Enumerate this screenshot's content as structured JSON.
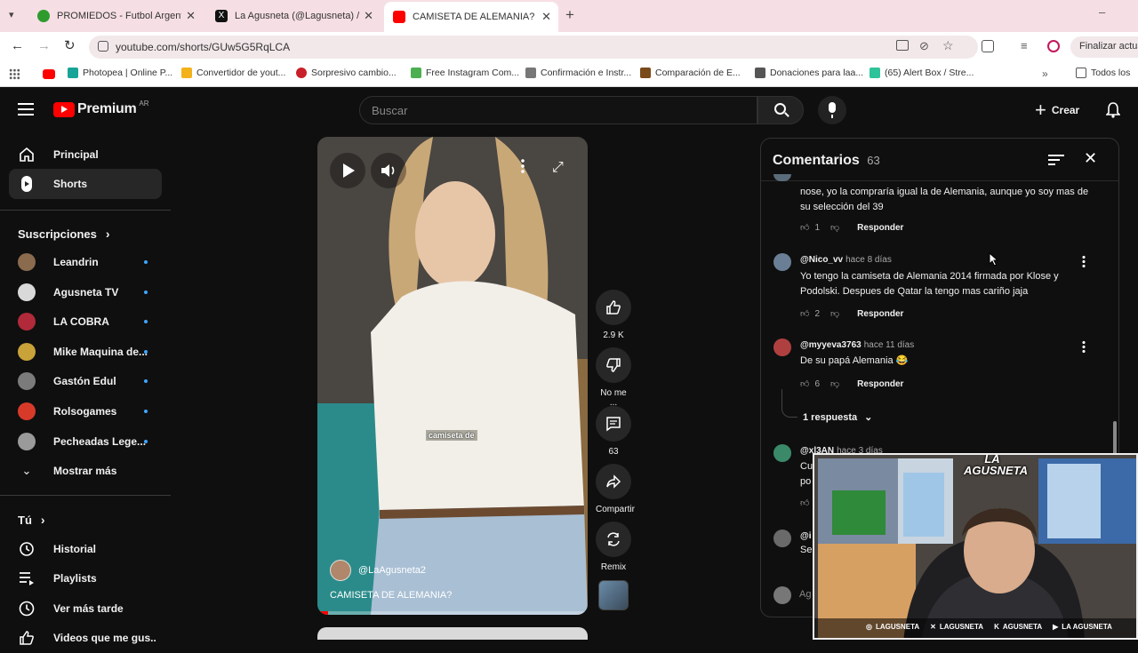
{
  "browser": {
    "tabs": [
      {
        "title": "PROMIEDOS - Futbol Argentino",
        "color": "#2e9b2e"
      },
      {
        "title": "La Agusneta (@Lagusneta) / X",
        "color": "#111111"
      },
      {
        "title": "CAMISETA DE ALEMANIA? - YouTube",
        "color": "#ff0000"
      }
    ],
    "url": "youtube.com/shorts/GUw5G5RqLCA",
    "profile_button": "Finalizar actual",
    "bookmarks": [
      {
        "label": "Photopea | Online P...",
        "color": "#18a497"
      },
      {
        "label": "Convertidor de yout...",
        "color": "#f3b21b"
      },
      {
        "label": "Sorpresivo cambio...",
        "color": "#c8202a"
      },
      {
        "label": "Free Instagram Com...",
        "color": "#4caf50"
      },
      {
        "label": "Confirmación e Instr...",
        "color": "#777777"
      },
      {
        "label": "Comparación de E...",
        "color": "#7a4a1a"
      },
      {
        "label": "Donaciones para laa...",
        "color": "#555555"
      },
      {
        "label": "(65) Alert Box / Stre...",
        "color": "#2fc39a"
      }
    ],
    "all_bookmarks": "Todos los"
  },
  "youtube": {
    "logo_text": "Premium",
    "country": "AR",
    "search_placeholder": "Buscar",
    "create_label": "Crear",
    "sidebar": {
      "main": [
        {
          "label": "Principal",
          "icon": "home-icon"
        },
        {
          "label": "Shorts",
          "icon": "shorts-icon"
        }
      ],
      "subs_title": "Suscripciones",
      "subs": [
        {
          "label": "Leandrin",
          "color": "#8a6b4e"
        },
        {
          "label": "Agusneta TV",
          "color": "#d9d9d9"
        },
        {
          "label": "LA COBRA",
          "color": "#b02a3a"
        },
        {
          "label": "Mike Maquina de...",
          "color": "#c9a23a"
        },
        {
          "label": "Gastón Edul",
          "color": "#7b7b7b"
        },
        {
          "label": "Rolsogames",
          "color": "#d83a2a"
        },
        {
          "label": "Pecheadas Lege...",
          "color": "#9a9a9a"
        }
      ],
      "show_more": "Mostrar más",
      "you_title": "Tú",
      "you": [
        {
          "label": "Historial",
          "icon": "history-icon"
        },
        {
          "label": "Playlists",
          "icon": "playlist-icon"
        },
        {
          "label": "Ver más tarde",
          "icon": "clock-icon"
        },
        {
          "label": "Videos que me gus..",
          "icon": "like-icon"
        }
      ]
    },
    "short": {
      "caption": "camiseta de",
      "channel": "@LaAgusneta2",
      "title": "CAMISETA DE ALEMANIA?"
    },
    "actions": {
      "likes": "2.9 K",
      "dislike": "No me ...",
      "comments": "63",
      "share": "Compartir",
      "remix": "Remix"
    },
    "comments_panel": {
      "title": "Comentarios",
      "count": "63",
      "reply_label": "Responder",
      "replies_toggle": "1 respuesta",
      "add_placeholder": "Ag",
      "comments": [
        {
          "author": "",
          "time": "",
          "text": "nose, yo la compraría igual la de Alemania, aunque yo soy mas de su selección del 39",
          "likes": "1",
          "avatar": "#5a6b7a"
        },
        {
          "author": "@Nico_vv",
          "time": "hace 8 días",
          "text": "Yo tengo la camiseta de Alemania 2014 firmada por Klose y Podolski. Despues de Qatar la tengo mas cariño jaja",
          "likes": "2",
          "avatar": "#6a7f95"
        },
        {
          "author": "@myyeva3763",
          "time": "hace 11 días",
          "text": "De su papá Alemania 😂",
          "likes": "6",
          "avatar": "#b04040"
        },
        {
          "author": "@xl3AN",
          "time": "hace 3 días",
          "text": "Cu",
          "text2": "po",
          "likes": "",
          "avatar": "#3a8a6a"
        },
        {
          "author": "@i",
          "time": "",
          "text": "Se",
          "likes": "",
          "avatar": "#6a6a6a"
        }
      ]
    }
  },
  "webcam": {
    "logo_text": "LA AGUSNETA",
    "socials": [
      "LAGUSNETA",
      "LAGUSNETA",
      "AGUSNETA",
      "LA AGUSNETA"
    ]
  }
}
